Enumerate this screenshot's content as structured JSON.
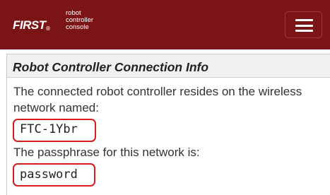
{
  "header": {
    "brand": "FIRST",
    "brand_mark": "®",
    "tagline": [
      "robot",
      "controller",
      "console"
    ],
    "menu_icon": "hamburger-menu-icon",
    "background_color": "#7b1416"
  },
  "panel": {
    "title": "Robot Controller Connection Info",
    "network_text_line1": "The connected robot controller resides on the wireless",
    "network_text_line2": "network named:",
    "network_name": "FTC-1Ybr",
    "passphrase_text": "The passphrase for this network is:",
    "passphrase": "password",
    "highlight_color": "#d81b1b"
  }
}
